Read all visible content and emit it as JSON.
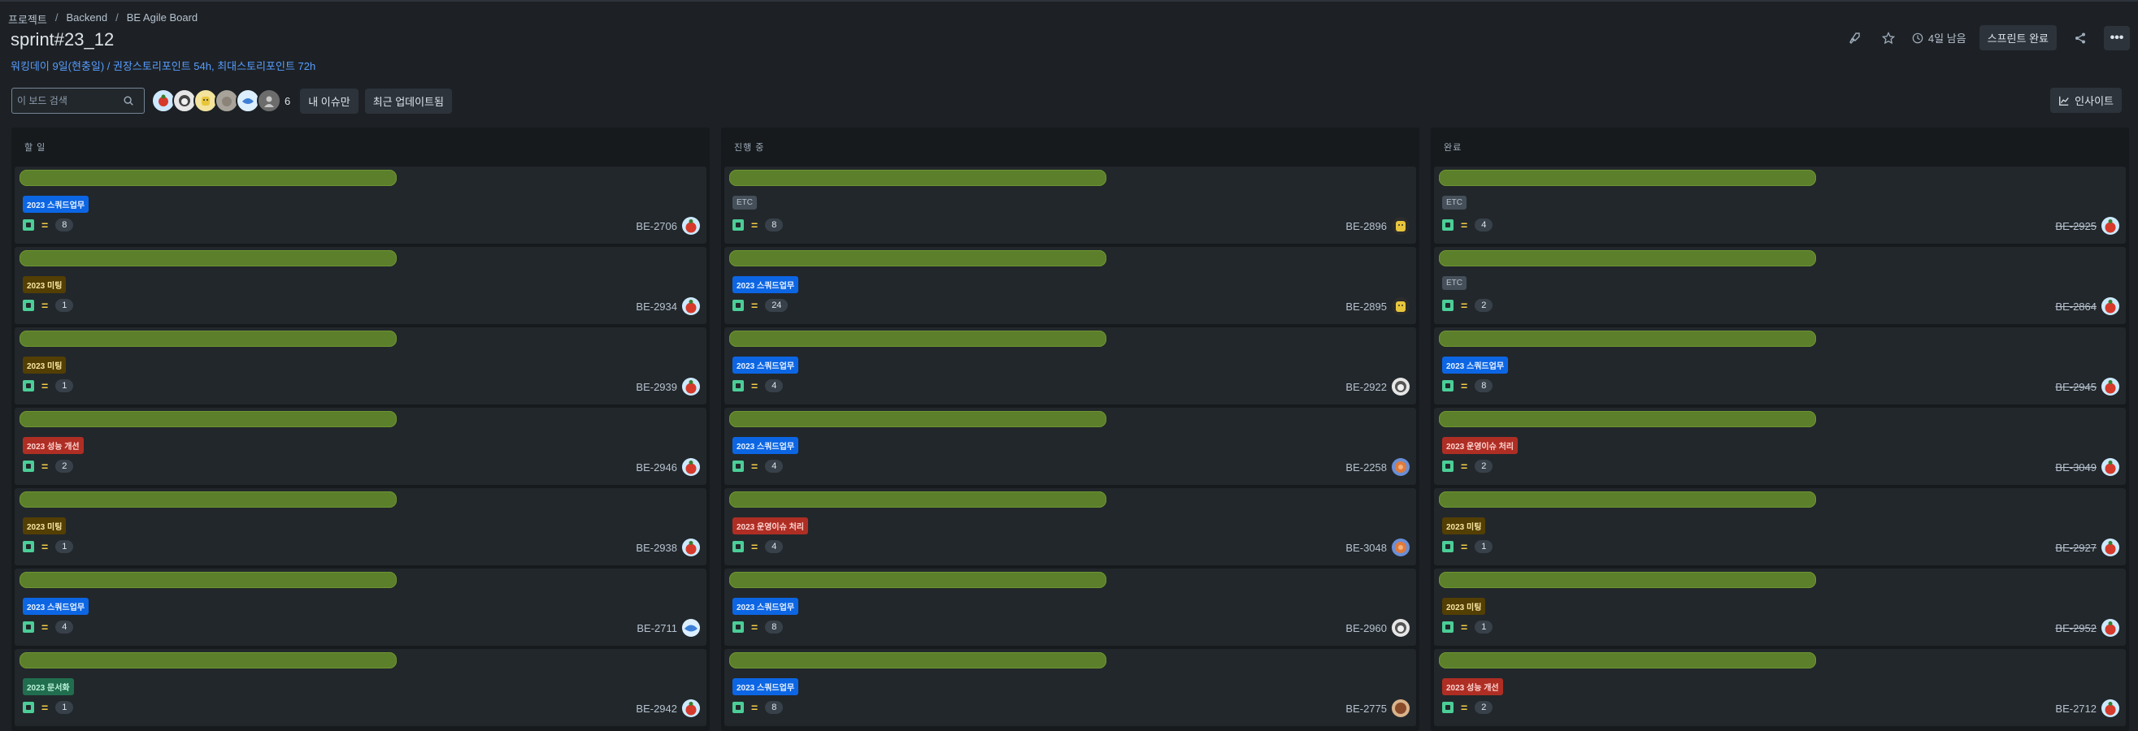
{
  "breadcrumb": [
    "프로젝트",
    "Backend",
    "BE Agile Board"
  ],
  "breadcrumb_separator": "/",
  "title": "sprint#23_12",
  "subtitle": "워킹데이 9일(현충일) / 권장스토리포인트 54h, 최대스토리포인트 72h",
  "header": {
    "remaining": "4일 남음",
    "complete_sprint": "스프린트 완료",
    "more": "•••",
    "icons": [
      "rocket-icon",
      "star-icon",
      "clock-icon",
      "share-icon",
      "more-icon"
    ]
  },
  "toolbar": {
    "search_placeholder": "이 보드 검색",
    "avatar_more": "6",
    "filter_my_issues": "내 이슈만",
    "filter_recent": "최근 업데이트됨",
    "insight": "인사이트"
  },
  "colors": {
    "summary_bar": "#5b7f2a",
    "epic_blue": "#0c66e4",
    "epic_gold": "#533f04",
    "epic_red": "#ae2e24",
    "epic_green": "#216e4e",
    "epic_gray": "#454f59"
  },
  "columns": [
    {
      "title": "할 일",
      "cards": [
        {
          "epic": "2023 스쿼드업무",
          "epic_color": "blue",
          "points": "8",
          "key": "BE-2706",
          "done": false,
          "avatar": "red"
        },
        {
          "epic": "2023 미팅",
          "epic_color": "gold",
          "points": "1",
          "key": "BE-2934",
          "done": false,
          "avatar": "red"
        },
        {
          "epic": "2023 미팅",
          "epic_color": "gold",
          "points": "1",
          "key": "BE-2939",
          "done": false,
          "avatar": "red"
        },
        {
          "epic": "2023 성능 개선",
          "epic_color": "red",
          "points": "2",
          "key": "BE-2946",
          "done": false,
          "avatar": "red"
        },
        {
          "epic": "2023 미팅",
          "epic_color": "gold",
          "points": "1",
          "key": "BE-2938",
          "done": false,
          "avatar": "red"
        },
        {
          "epic": "2023 스쿼드업무",
          "epic_color": "blue",
          "points": "4",
          "key": "BE-2711",
          "done": false,
          "avatar": "blue"
        },
        {
          "epic": "2023 문서화",
          "epic_color": "green",
          "points": "1",
          "key": "BE-2942",
          "done": false,
          "avatar": "red"
        }
      ]
    },
    {
      "title": "진행 중",
      "cards": [
        {
          "epic": "ETC",
          "epic_color": "gray",
          "points": "8",
          "key": "BE-2896",
          "done": false,
          "avatar": "yellow"
        },
        {
          "epic": "2023 스쿼드업무",
          "epic_color": "blue",
          "points": "24",
          "key": "BE-2895",
          "done": false,
          "avatar": "yellow"
        },
        {
          "epic": "2023 스쿼드업무",
          "epic_color": "blue",
          "points": "4",
          "key": "BE-2922",
          "done": false,
          "avatar": "gray"
        },
        {
          "epic": "2023 스쿼드업무",
          "epic_color": "blue",
          "points": "4",
          "key": "BE-2258",
          "done": false,
          "avatar": "orange"
        },
        {
          "epic": "2023 운영이슈 처리",
          "epic_color": "red",
          "points": "4",
          "key": "BE-3048",
          "done": false,
          "avatar": "orange"
        },
        {
          "epic": "2023 스쿼드업무",
          "epic_color": "blue",
          "points": "8",
          "key": "BE-2960",
          "done": false,
          "avatar": "gray"
        },
        {
          "epic": "2023 스쿼드업무",
          "epic_color": "blue",
          "points": "8",
          "key": "BE-2775",
          "done": false,
          "avatar": "brown"
        }
      ]
    },
    {
      "title": "완료",
      "cards": [
        {
          "epic": "ETC",
          "epic_color": "gray",
          "points": "4",
          "key": "BE-2925",
          "done": true,
          "avatar": "red"
        },
        {
          "epic": "ETC",
          "epic_color": "gray",
          "points": "2",
          "key": "BE-2864",
          "done": true,
          "avatar": "red"
        },
        {
          "epic": "2023 스쿼드업무",
          "epic_color": "blue",
          "points": "8",
          "key": "BE-2945",
          "done": true,
          "avatar": "red"
        },
        {
          "epic": "2023 운영이슈 처리",
          "epic_color": "red",
          "points": "2",
          "key": "BE-3049",
          "done": true,
          "avatar": "red"
        },
        {
          "epic": "2023 미팅",
          "epic_color": "gold",
          "points": "1",
          "key": "BE-2927",
          "done": true,
          "avatar": "red"
        },
        {
          "epic": "2023 미팅",
          "epic_color": "gold",
          "points": "1",
          "key": "BE-2952",
          "done": true,
          "avatar": "red"
        },
        {
          "epic": "2023 성능 개선",
          "epic_color": "red",
          "points": "2",
          "key": "BE-2712",
          "done": false,
          "avatar": "red"
        }
      ]
    }
  ]
}
